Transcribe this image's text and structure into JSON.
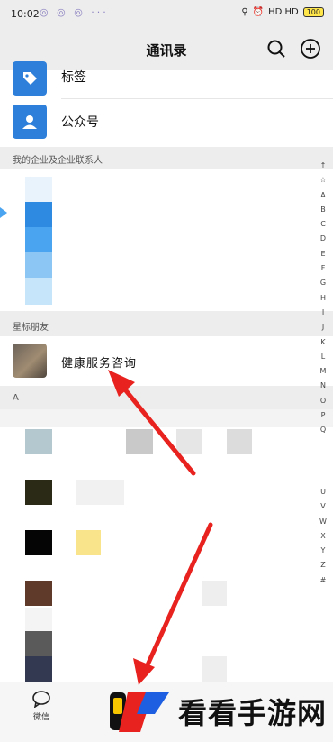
{
  "status_bar": {
    "time": "10:02",
    "notif_dots": "◎ ◎ ◎ ···",
    "right_text": "HD HD",
    "battery": "100"
  },
  "header": {
    "title": "通讯录",
    "search_icon": "search-icon",
    "add_icon": "plus-circle-icon"
  },
  "top_rows": [
    {
      "label": "标签",
      "icon": "tag-icon"
    },
    {
      "label": "公众号",
      "icon": "person-icon"
    }
  ],
  "sections": {
    "enterprise": "我的企业及企业联系人",
    "starred": "星标朋友",
    "a": "A"
  },
  "starred_contact": {
    "name": "健康服务咨询"
  },
  "index_letters_top": [
    "↑",
    "☆",
    "A",
    "B",
    "C",
    "D",
    "E",
    "F",
    "G",
    "H",
    "I",
    "J",
    "K",
    "L",
    "M",
    "N",
    "O",
    "P",
    "Q"
  ],
  "index_letters_bottom": [
    "U",
    "V",
    "W",
    "X",
    "Y",
    "Z",
    "#"
  ],
  "tabbar": {
    "chat_label": "微信",
    "chat_icon": "chat-bubble-icon"
  },
  "watermark": {
    "text": "看看手游网"
  },
  "colors": {
    "accent_blue": "#2d7fd9",
    "arrow_red": "#e8231f",
    "gray_bg": "#ededed"
  }
}
